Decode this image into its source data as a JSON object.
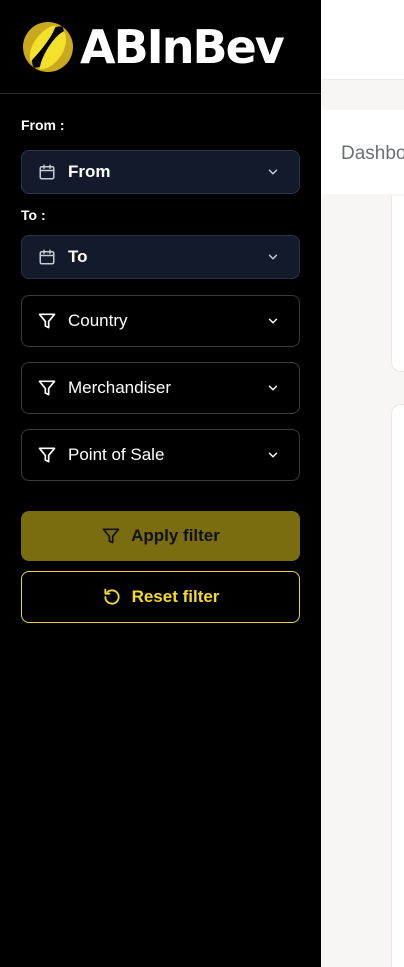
{
  "brand": {
    "name": "ABInBev",
    "accent": "#f3d92b"
  },
  "header": {
    "tab_label": "Dashbo"
  },
  "filters": {
    "from": {
      "label": "From :",
      "value": "From",
      "icon": "calendar-icon"
    },
    "to": {
      "label": "To :",
      "value": "To",
      "icon": "calendar-icon"
    },
    "country": {
      "value": "Country",
      "icon": "filter-icon"
    },
    "merchandiser": {
      "value": "Merchandiser",
      "icon": "filter-icon"
    },
    "point_of_sale": {
      "value": "Point of Sale",
      "icon": "filter-icon"
    }
  },
  "actions": {
    "apply": {
      "label": "Apply filter",
      "icon": "filter-icon",
      "color": "#7a6d10"
    },
    "reset": {
      "label": "Reset filter",
      "icon": "reset-icon",
      "color": "#f3d92b"
    }
  }
}
